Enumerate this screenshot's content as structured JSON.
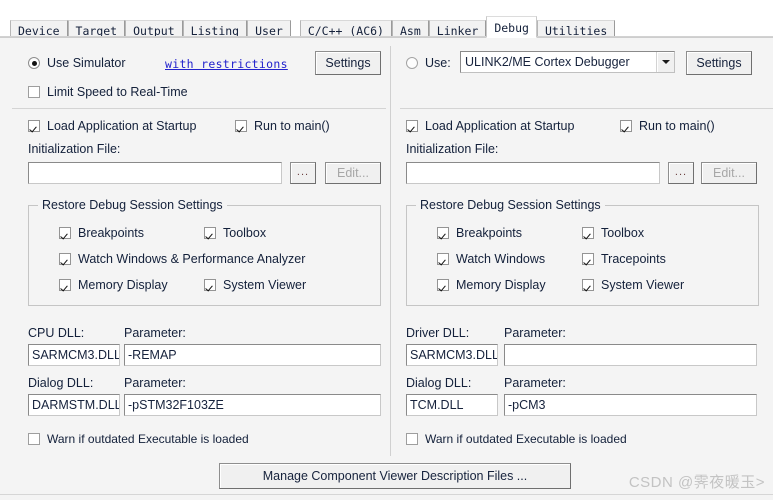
{
  "tabs": [
    {
      "label": "Device",
      "active": false,
      "gap": false
    },
    {
      "label": "Target",
      "active": false,
      "gap": false
    },
    {
      "label": "Output",
      "active": false,
      "gap": false
    },
    {
      "label": "Listing",
      "active": false,
      "gap": false
    },
    {
      "label": "User",
      "active": false,
      "gap": false
    },
    {
      "label": "C/C++ (AC6)",
      "active": false,
      "gap": true
    },
    {
      "label": "Asm",
      "active": false,
      "gap": false
    },
    {
      "label": "Linker",
      "active": false,
      "gap": false
    },
    {
      "label": "Debug",
      "active": true,
      "gap": false
    },
    {
      "label": "Utilities",
      "active": false,
      "gap": false
    }
  ],
  "left": {
    "use_simulator_label": "Use Simulator",
    "use_simulator_checked": true,
    "restrictions_link": "with restrictions",
    "settings_button": "Settings",
    "limit_speed_label": "Limit Speed to Real-Time",
    "limit_speed_checked": false,
    "load_app_label": "Load Application at Startup",
    "load_app_checked": true,
    "run_to_main_label": "Run to main()",
    "run_to_main_checked": true,
    "init_file_label": "Initialization File:",
    "init_file_value": "",
    "browse_button": "...",
    "edit_button": "Edit...",
    "restore_group_title": "Restore Debug Session Settings",
    "restore_items": [
      {
        "label": "Breakpoints",
        "checked": true
      },
      {
        "label": "Toolbox",
        "checked": true
      },
      {
        "label": "Watch Windows & Performance Analyzer",
        "checked": true
      },
      {
        "label": "Memory Display",
        "checked": true
      },
      {
        "label": "System Viewer",
        "checked": true
      }
    ],
    "cpu_dll_label": "CPU DLL:",
    "cpu_dll_value": "SARMCM3.DLL",
    "cpu_param_label": "Parameter:",
    "cpu_param_value": "-REMAP",
    "dialog_dll_label": "Dialog DLL:",
    "dialog_dll_value": "DARMSTM.DLL",
    "dialog_param_label": "Parameter:",
    "dialog_param_value": "-pSTM32F103ZE",
    "warn_outdated_label": "Warn if outdated Executable is loaded",
    "warn_outdated_checked": false
  },
  "right": {
    "use_label": "Use:",
    "use_checked": false,
    "debugger_selected": "ULINK2/ME Cortex Debugger",
    "settings_button": "Settings",
    "load_app_label": "Load Application at Startup",
    "load_app_checked": true,
    "run_to_main_label": "Run to main()",
    "run_to_main_checked": true,
    "init_file_label": "Initialization File:",
    "init_file_value": "",
    "browse_button": "...",
    "edit_button": "Edit...",
    "restore_group_title": "Restore Debug Session Settings",
    "restore_items": [
      {
        "label": "Breakpoints",
        "checked": true
      },
      {
        "label": "Toolbox",
        "checked": true
      },
      {
        "label": "Watch Windows",
        "checked": true
      },
      {
        "label": "Tracepoints",
        "checked": true
      },
      {
        "label": "Memory Display",
        "checked": true
      },
      {
        "label": "System Viewer",
        "checked": true
      }
    ],
    "driver_dll_label": "Driver DLL:",
    "driver_dll_value": "SARMCM3.DLL",
    "driver_param_label": "Parameter:",
    "driver_param_value": "",
    "dialog_dll_label": "Dialog DLL:",
    "dialog_dll_value": "TCM.DLL",
    "dialog_param_label": "Parameter:",
    "dialog_param_value": "-pCM3",
    "warn_outdated_label": "Warn if outdated Executable is loaded",
    "warn_outdated_checked": false
  },
  "footer": {
    "manage_button": "Manage Component Viewer Description Files ...",
    "watermark": "CSDN @霁夜暖玉>"
  },
  "colors": {
    "dialog_bg": "#f4f4f4",
    "link": "#2222cc",
    "text": "#13203a",
    "field_bg": "#ffffff"
  }
}
